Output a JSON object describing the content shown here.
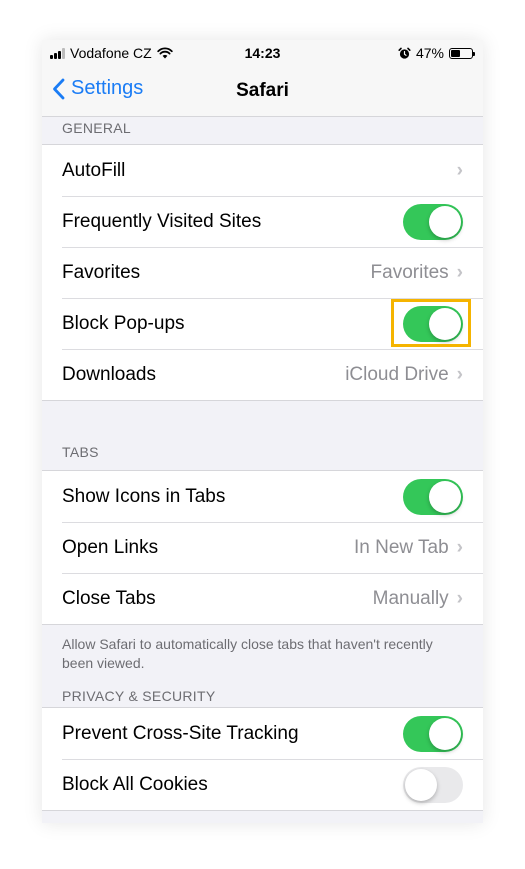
{
  "status_bar": {
    "carrier": "Vodafone CZ",
    "time": "14:23",
    "battery": "47%",
    "battery_level": 0.47
  },
  "nav": {
    "back_label": "Settings",
    "title": "Safari"
  },
  "sections": {
    "general": {
      "header": "GENERAL",
      "autofill": "AutoFill",
      "frequently_visited": "Frequently Visited Sites",
      "favorites": "Favorites",
      "favorites_value": "Favorites",
      "block_popups": "Block Pop-ups",
      "downloads": "Downloads",
      "downloads_value": "iCloud Drive"
    },
    "tabs": {
      "header": "TABS",
      "show_icons": "Show Icons in Tabs",
      "open_links": "Open Links",
      "open_links_value": "In New Tab",
      "close_tabs": "Close Tabs",
      "close_tabs_value": "Manually",
      "footnote": "Allow Safari to automatically close tabs that haven't recently been viewed."
    },
    "privacy": {
      "header": "PRIVACY & SECURITY",
      "prevent_tracking": "Prevent Cross-Site Tracking",
      "block_cookies": "Block All Cookies"
    }
  },
  "toggles": {
    "frequently_visited": true,
    "block_popups": true,
    "show_icons": true,
    "prevent_tracking": true,
    "block_cookies": false
  },
  "colors": {
    "accent": "#1a7cf5",
    "toggle_on": "#34c759",
    "highlight": "#f5b400"
  },
  "icons": [
    "cellular-signal-icon",
    "wifi-icon",
    "alarm-icon",
    "battery-icon",
    "back-chevron-icon",
    "chevron-right-icon"
  ]
}
